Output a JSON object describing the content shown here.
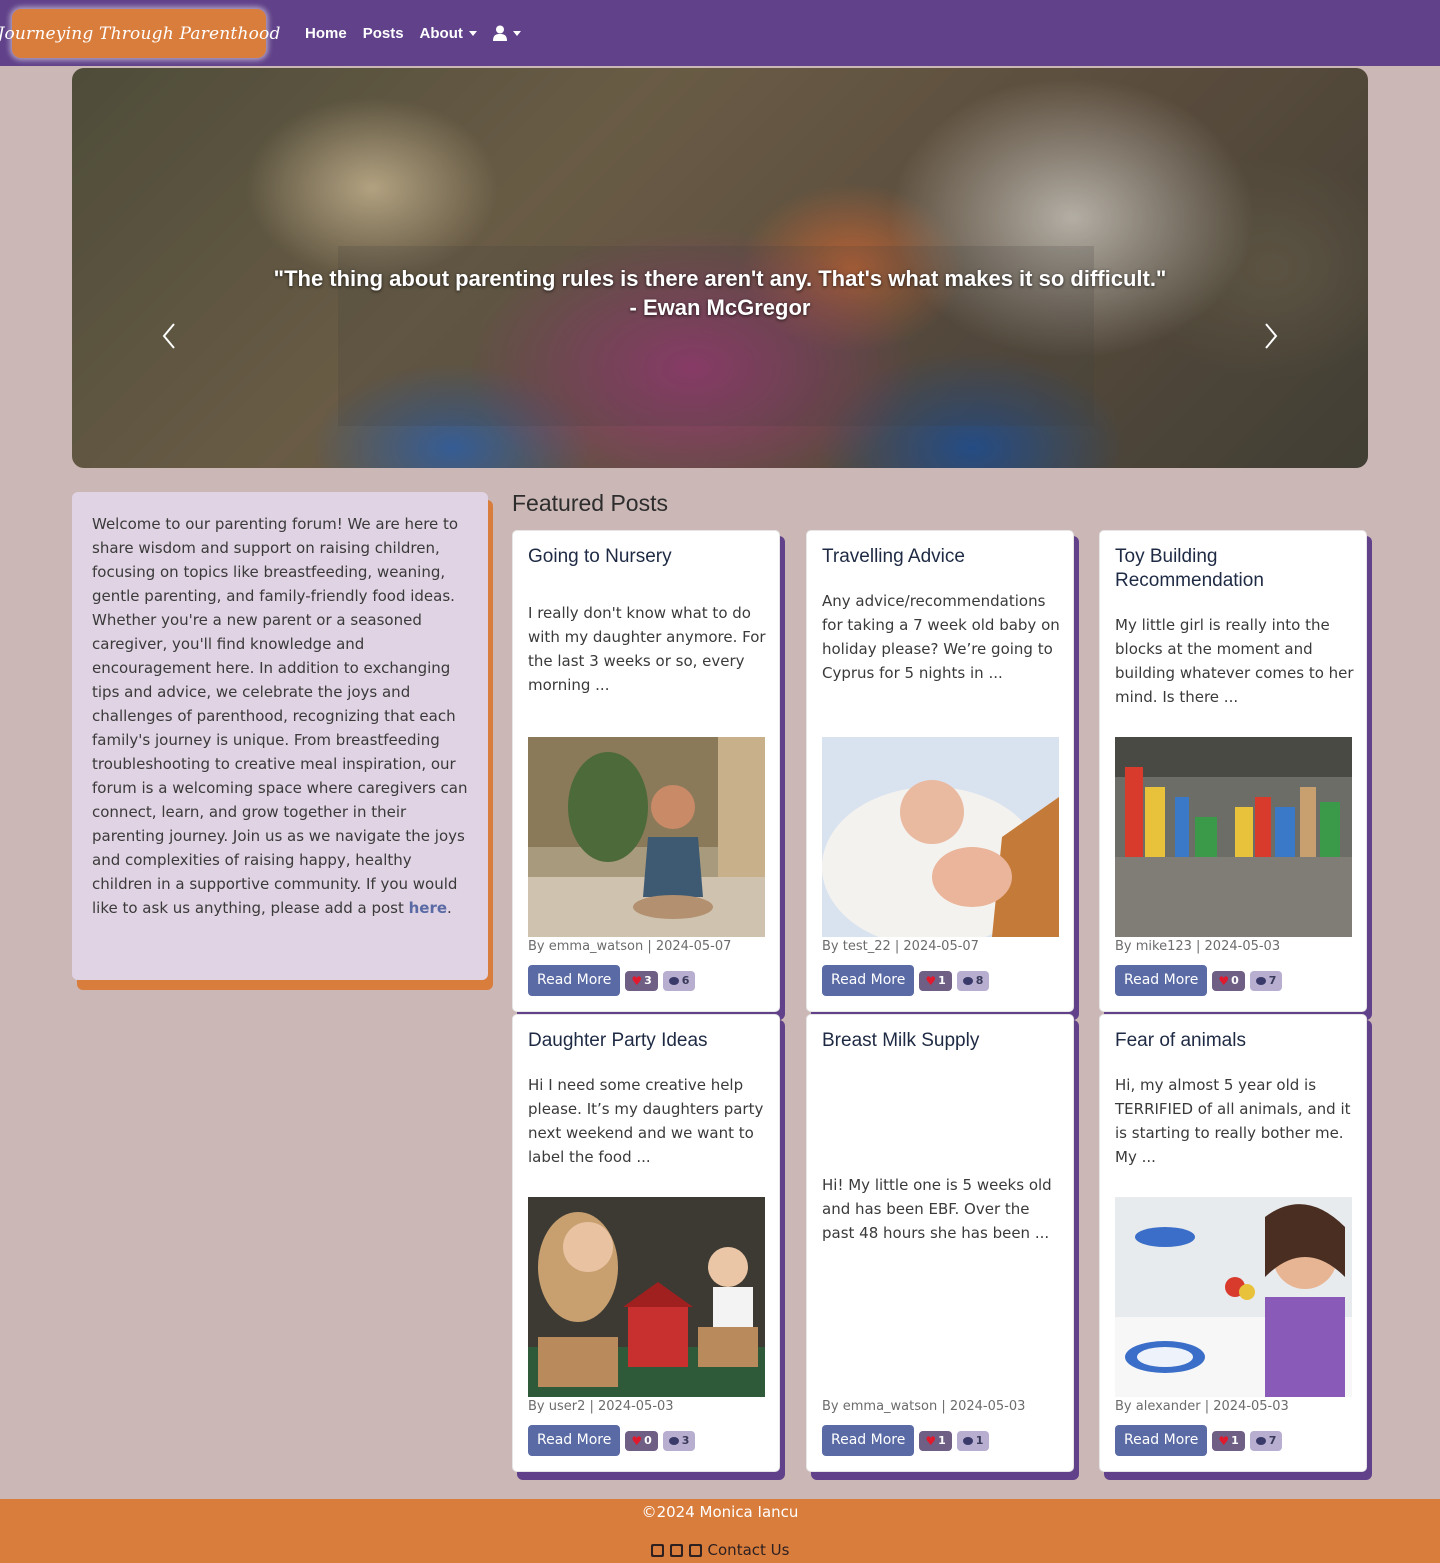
{
  "nav": {
    "brand": "Journeying Through Parenthood",
    "home": "Home",
    "posts": "Posts",
    "about": "About"
  },
  "hero": {
    "quote": "\"The thing about parenting rules is there aren't any. That's what makes it so difficult.\" - Ewan McGregor"
  },
  "intro": {
    "text": "Welcome to our parenting forum! We are here to share wisdom and support on raising children, focusing on topics like breastfeeding, weaning, gentle parenting, and family-friendly food ideas. Whether you're a new parent or a seasoned caregiver, you'll find knowledge and encouragement here. In addition to exchanging tips and advice, we celebrate the joys and challenges of parenthood, recognizing that each family's journey is unique. From breastfeeding troubleshooting to creative meal inspiration, our forum is a welcoming space where caregivers can connect, learn, and grow together in their parenting journey. Join us as we navigate the joys and complexities of raising happy, healthy children in a supportive community. If you would like to ask us anything, please add a post ",
    "link": "here",
    "end": "."
  },
  "featured": {
    "title": "Featured Posts",
    "read_more": "Read More",
    "posts": [
      {
        "title": "Going to Nursery",
        "excerpt": "I really don't know what to do with my daughter anymore. For the last 3 weeks or so, every morning ...",
        "meta": "By emma_watson | 2024-05-07",
        "likes": "3",
        "comments": "6"
      },
      {
        "title": "Travelling Advice",
        "excerpt": "Any advice/recommendations for taking a 7 week old baby on holiday please? We’re going to Cyprus for 5 nights in ...",
        "meta": "By test_22 | 2024-05-07",
        "likes": "1",
        "comments": "8"
      },
      {
        "title": "Toy Building Recommendation",
        "excerpt": "My little girl is really into the blocks at the moment and building whatever comes to her mind. Is there ...",
        "meta": "By mike123 | 2024-05-03",
        "likes": "0",
        "comments": "7"
      },
      {
        "title": "Daughter Party Ideas",
        "excerpt": "Hi I need some creative help please. It’s my daughters party next weekend and we want to label the food ...",
        "meta": "By user2 | 2024-05-03",
        "likes": "0",
        "comments": "3"
      },
      {
        "title": "Breast Milk Supply",
        "excerpt": "Hi! My little one is 5 weeks old and has been EBF. Over the past 48 hours she has been ...",
        "meta": "By emma_watson | 2024-05-03",
        "likes": "1",
        "comments": "1"
      },
      {
        "title": "Fear of animals",
        "excerpt": "Hi, my almost 5 year old is TERRIFIED of all animals, and it is starting to really bother me. My ...",
        "meta": "By alexander | 2024-05-03",
        "likes": "1",
        "comments": "7"
      }
    ]
  },
  "footer": {
    "copyright": "©2024 Monica Iancu",
    "contact": "Contact Us"
  }
}
